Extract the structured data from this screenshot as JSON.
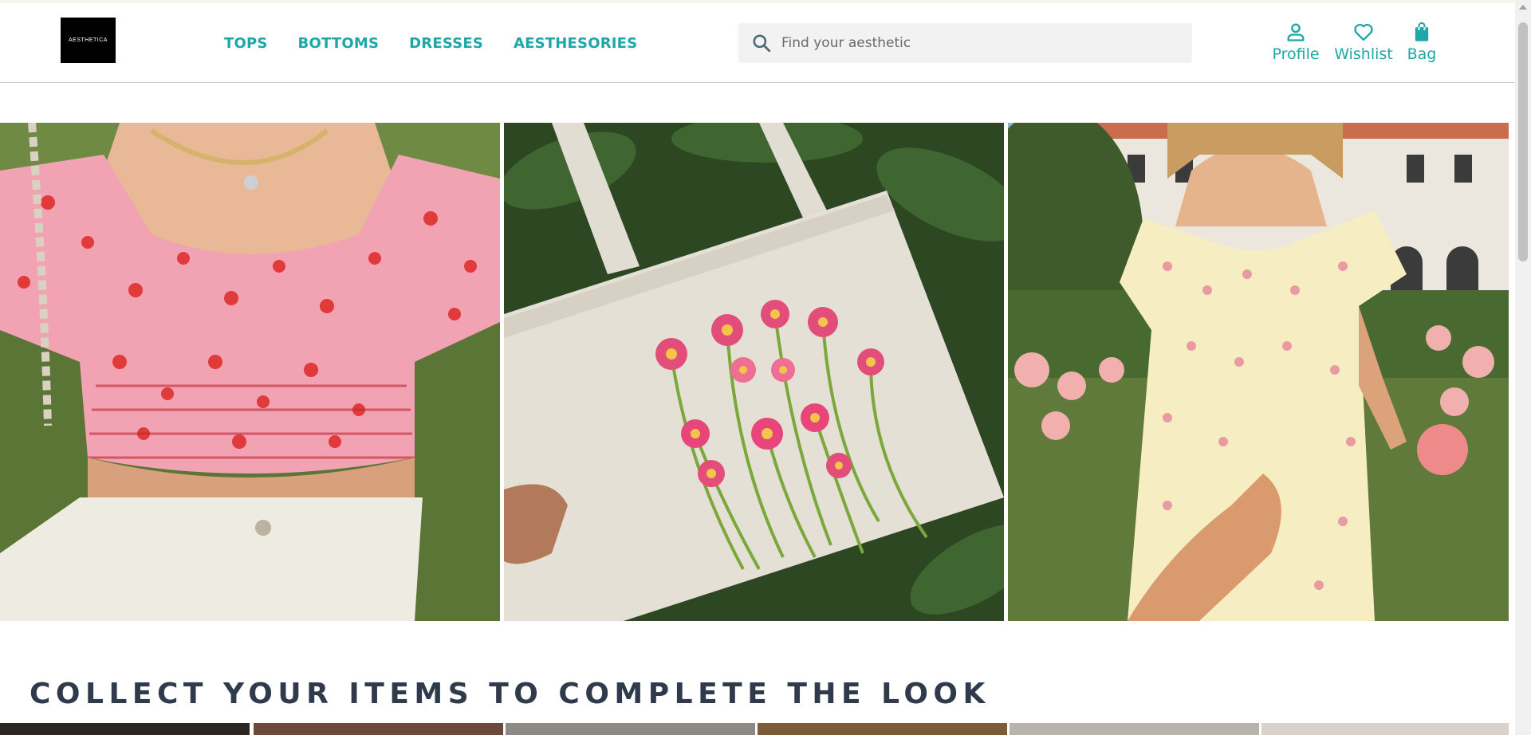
{
  "brand": {
    "logo_text": "AESTHETICA"
  },
  "nav": {
    "menu": [
      {
        "label": "TOPS"
      },
      {
        "label": "BOTTOMS"
      },
      {
        "label": "DRESSES"
      },
      {
        "label": "AESTHESORIES"
      }
    ]
  },
  "search": {
    "placeholder": "Find your aesthetic",
    "value": ""
  },
  "actions": {
    "profile": {
      "label": "Profile",
      "icon": "user-icon"
    },
    "wishlist": {
      "label": "Wishlist",
      "icon": "heart-icon"
    },
    "bag": {
      "label": "Bag",
      "icon": "shopping-bag-icon"
    }
  },
  "hero": {
    "images": [
      {
        "name": "hero-image-red-floral-top"
      },
      {
        "name": "hero-image-floral-tote-bag"
      },
      {
        "name": "hero-image-floral-dress"
      }
    ]
  },
  "section": {
    "title": "COLLECT YOUR ITEMS TO COMPLETE THE LOOK"
  },
  "colors": {
    "accent": "#1fa7a8",
    "heading": "#2f3a4a",
    "logo_bg": "#000000"
  }
}
